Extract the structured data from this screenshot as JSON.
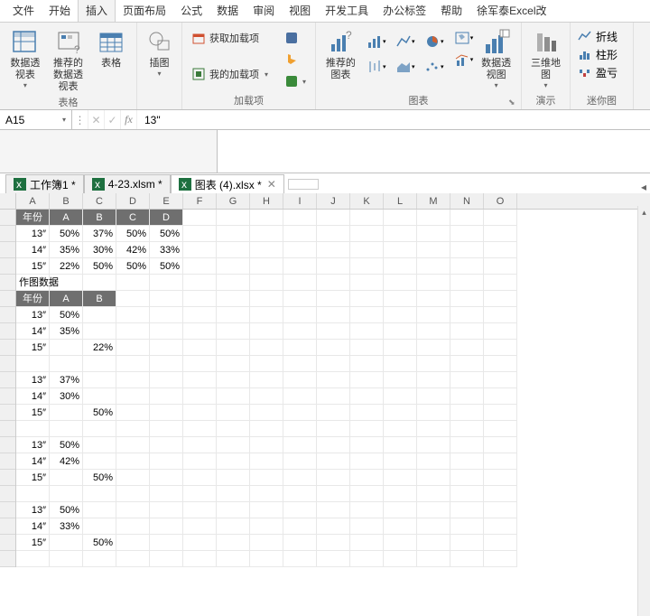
{
  "tabs": {
    "file": "文件",
    "home": "开始",
    "insert": "插入",
    "layout": "页面布局",
    "formula": "公式",
    "data": "数据",
    "review": "审阅",
    "view": "视图",
    "dev": "开发工具",
    "office": "办公标签",
    "help": "帮助",
    "author": "徐军泰Excel改"
  },
  "ribbon": {
    "tables": {
      "label": "表格",
      "pivot": "数据透\n视表",
      "recpivot": "推荐的\n数据透视表",
      "table": "表格"
    },
    "illus": {
      "icon": "插图"
    },
    "addins": {
      "label": "加载项",
      "get": "获取加载项",
      "my": "我的加载项"
    },
    "charts": {
      "label": "图表",
      "rec": "推荐的\n图表",
      "pivotchart": "数据透视图"
    },
    "demo": {
      "label": "演示",
      "map": "三维地\n图"
    },
    "spark": {
      "label": "迷你图",
      "line": "折线",
      "col": "柱形",
      "winloss": "盈亏"
    }
  },
  "namebox": "A15",
  "formula": "13\"",
  "wbtabs": [
    {
      "name": "工作簿1 *"
    },
    {
      "name": "4-23.xlsm *"
    },
    {
      "name": "图表 (4).xlsx *",
      "active": true
    }
  ],
  "cols": [
    "A",
    "B",
    "C",
    "D",
    "E",
    "F",
    "G",
    "H",
    "I",
    "J",
    "K",
    "L",
    "M",
    "N",
    "O"
  ],
  "sheet": {
    "hdr1": {
      "c1": "年份",
      "c2": "A",
      "c3": "B",
      "c4": "C",
      "c5": "D"
    },
    "r1": {
      "c1": "13″",
      "c2": "50%",
      "c3": "37%",
      "c4": "50%",
      "c5": "50%"
    },
    "r2": {
      "c1": "14″",
      "c2": "35%",
      "c3": "30%",
      "c4": "42%",
      "c5": "33%"
    },
    "r3": {
      "c1": "15″",
      "c2": "22%",
      "c3": "50%",
      "c4": "50%",
      "c5": "50%"
    },
    "sect": "作图数据",
    "hdr2": {
      "c1": "年份",
      "c2": "A",
      "c3": "B"
    },
    "d": [
      {
        "c1": "13″",
        "c2": "50%",
        "c3": ""
      },
      {
        "c1": "14″",
        "c2": "35%",
        "c3": ""
      },
      {
        "c1": "15″",
        "c2": "",
        "c3": "22%"
      },
      {
        "c1": "",
        "c2": "",
        "c3": ""
      },
      {
        "c1": "13″",
        "c2": "37%",
        "c3": ""
      },
      {
        "c1": "14″",
        "c2": "30%",
        "c3": ""
      },
      {
        "c1": "15″",
        "c2": "",
        "c3": "50%"
      },
      {
        "c1": "",
        "c2": "",
        "c3": ""
      },
      {
        "c1": "13″",
        "c2": "50%",
        "c3": ""
      },
      {
        "c1": "14″",
        "c2": "42%",
        "c3": ""
      },
      {
        "c1": "15″",
        "c2": "",
        "c3": "50%"
      },
      {
        "c1": "",
        "c2": "",
        "c3": ""
      },
      {
        "c1": "13″",
        "c2": "50%",
        "c3": ""
      },
      {
        "c1": "14″",
        "c2": "33%",
        "c3": ""
      },
      {
        "c1": "15″",
        "c2": "",
        "c3": "50%"
      }
    ]
  }
}
